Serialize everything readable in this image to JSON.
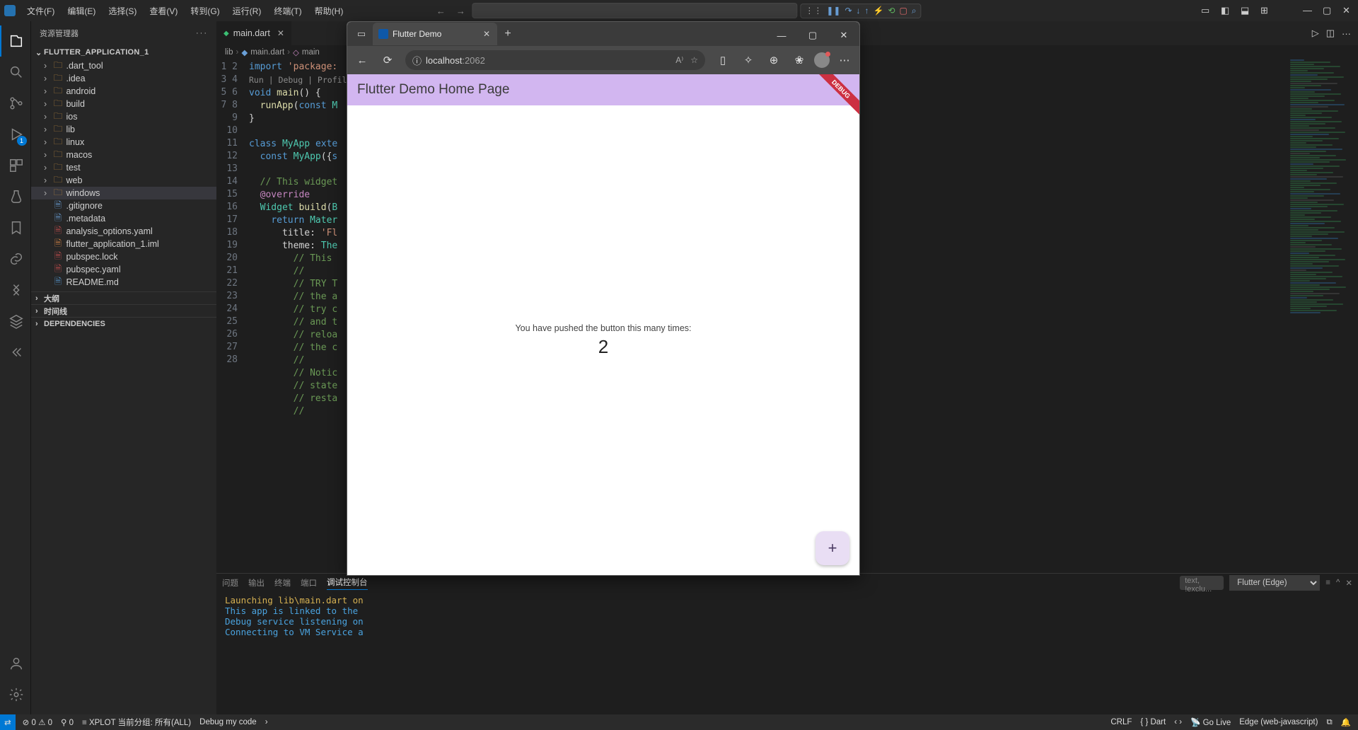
{
  "menus": [
    "文件(F)",
    "编辑(E)",
    "选择(S)",
    "查看(V)",
    "转到(G)",
    "运行(R)",
    "终端(T)",
    "帮助(H)"
  ],
  "sidebar": {
    "title": "资源管理器",
    "project": "FLUTTER_APPLICATION_1",
    "folders": [
      ".dart_tool",
      ".idea",
      "android",
      "build",
      "ios",
      "lib",
      "linux",
      "macos",
      "test",
      "web",
      "windows"
    ],
    "selectedFolder": "windows",
    "files": [
      {
        "name": ".gitignore",
        "cls": "file"
      },
      {
        "name": ".metadata",
        "cls": "file"
      },
      {
        "name": "analysis_options.yaml",
        "cls": "yaml"
      },
      {
        "name": "flutter_application_1.iml",
        "cls": "iml"
      },
      {
        "name": "pubspec.lock",
        "cls": "yaml"
      },
      {
        "name": "pubspec.yaml",
        "cls": "yaml"
      },
      {
        "name": "README.md",
        "cls": "md"
      }
    ],
    "sections": [
      "大纲",
      "时间线",
      "DEPENDENCIES"
    ]
  },
  "tab": {
    "name": "main.dart"
  },
  "breadcrumb": {
    "a": "lib",
    "b": "main.dart",
    "c": "main"
  },
  "code": {
    "runDebug": "Run | Debug | Profile",
    "lines": [
      "import 'package:",
      "",
      "void main() {",
      "  runApp(const M",
      "}",
      "",
      "class MyApp exte",
      "  const MyApp({s",
      "",
      "  // This widget",
      "  @override",
      "  Widget build(B",
      "    return Mater",
      "      title: 'Fl",
      "      theme: The",
      "        // This ",
      "        //",
      "        // TRY T",
      "        // the a",
      "        // try c",
      "        // and t",
      "        // reloa",
      "        // the c",
      "        //",
      "        // Notic",
      "        // state",
      "        // resta",
      "        //"
    ]
  },
  "panel": {
    "tabs": [
      "问题",
      "输出",
      "终端",
      "端口",
      "调试控制台"
    ],
    "active": 4,
    "filterPlaceholder": "text,  !exclu...",
    "dropdown": "Flutter (Edge)",
    "lines": [
      "Launching lib\\main.dart on",
      "This app is linked to the ",
      "Debug service listening on",
      "Connecting to VM Service a"
    ]
  },
  "status": {
    "errors": "0",
    "warnings": "0",
    "ports": "0",
    "xplot": "XPLOT 当前分组: 所有(ALL)",
    "debugMy": "Debug my code",
    "eol": "CRLF",
    "lang": "Dart",
    "goLive": "Go Live",
    "device": "Edge (web-javascript)"
  },
  "browser": {
    "tabTitle": "Flutter Demo",
    "host": "localhost",
    "port": ":2062",
    "appbarTitle": "Flutter Demo Home Page",
    "debugRibbon": "DEBUG",
    "message": "You have pushed the button this many times:",
    "count": "2"
  },
  "activityBadge": "1"
}
